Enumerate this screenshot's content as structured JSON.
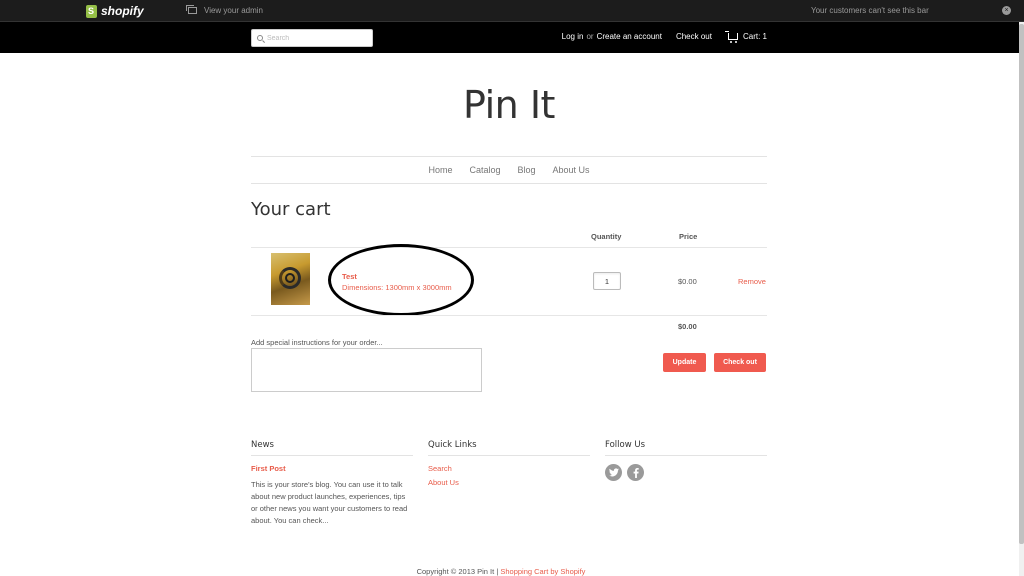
{
  "admin_bar": {
    "brand": "shopify",
    "view_admin": "View your admin",
    "notice": "Your customers can't see this bar",
    "close_icon": "×"
  },
  "store_bar": {
    "search_placeholder": "Search",
    "login": "Log in",
    "or": "or",
    "create_account": "Create an account",
    "checkout": "Check out",
    "cart": "Cart: 1"
  },
  "site": {
    "title": "Pin It"
  },
  "nav": {
    "items": [
      "Home",
      "Catalog",
      "Blog",
      "About Us"
    ]
  },
  "cart": {
    "heading": "Your cart",
    "columns": {
      "quantity": "Quantity",
      "price": "Price"
    },
    "items": [
      {
        "title": "Test",
        "variant": "Dimensions: 1300mm x 3000mm",
        "quantity": "1",
        "price": "$0.00",
        "remove_label": "Remove"
      }
    ],
    "subtotal": "$0.00",
    "instructions_label": "Add special instructions for your order...",
    "update_button": "Update",
    "checkout_button": "Check out"
  },
  "footer": {
    "news": {
      "heading": "News",
      "post_title": "First Post",
      "post_excerpt": "This is your store's blog. You can use it to talk about new product launches, experiences, tips or other news you want your customers to read about. You can check..."
    },
    "quick_links": {
      "heading": "Quick Links",
      "links": [
        "Search",
        "About Us"
      ]
    },
    "follow": {
      "heading": "Follow Us",
      "icons": [
        "twitter-icon",
        "facebook-icon"
      ]
    },
    "copyright": "Copyright © 2013 Pin It |",
    "powered_by": "Shopping Cart by Shopify"
  },
  "colors": {
    "accent": "#f05a4f",
    "link": "#e85c4a",
    "header_bg": "#000000",
    "admin_bg": "#1c1c1c"
  }
}
